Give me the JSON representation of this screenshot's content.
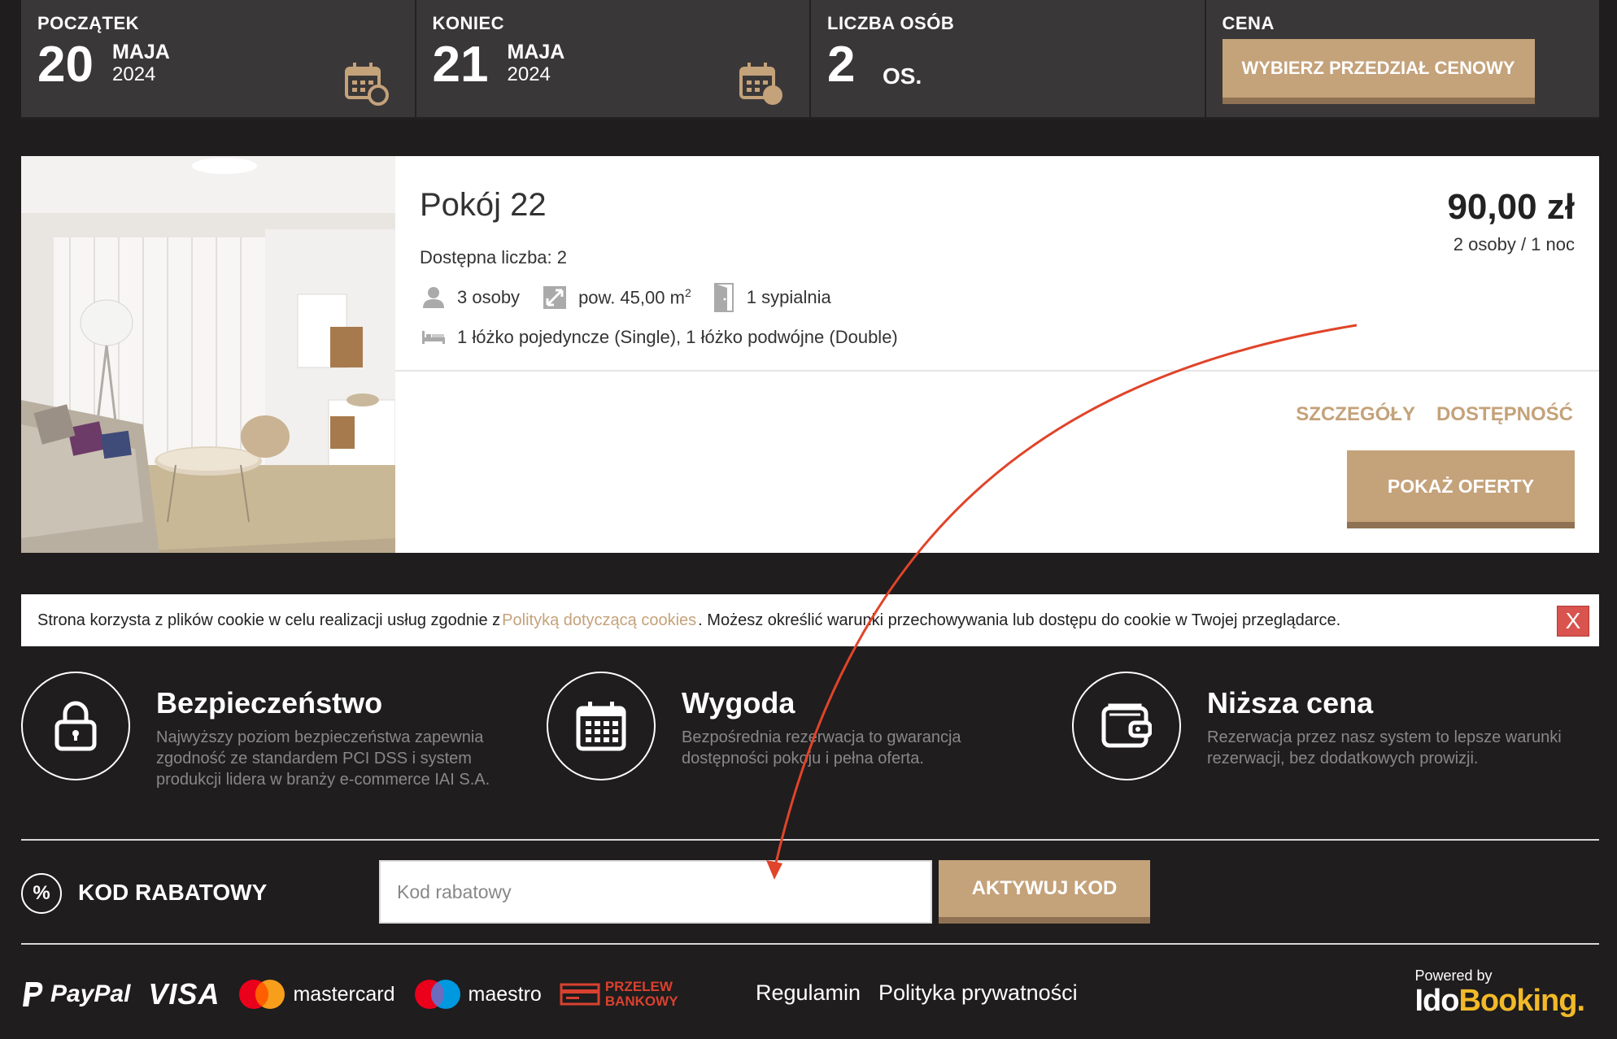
{
  "search": {
    "start": {
      "label": "POCZĄTEK",
      "day": "20",
      "month": "MAJA",
      "year": "2024"
    },
    "end": {
      "label": "KONIEC",
      "day": "21",
      "month": "MAJA",
      "year": "2024"
    },
    "guests": {
      "label": "LICZBA OSÓB",
      "count": "2",
      "unit": "OS."
    },
    "price": {
      "label": "CENA",
      "button": "WYBIERZ PRZEDZIAŁ CENOWY"
    }
  },
  "room": {
    "title": "Pokój 22",
    "availability": "Dostępna liczba: 2",
    "persons": "3 osoby",
    "area": "pow. 45,00 m",
    "area_sup": "2",
    "bedrooms": "1 sypialnia",
    "beds": "1 łóżko pojedyncze (Single), 1 łóżko podwójne (Double)",
    "price": "90,00 zł",
    "price_sub": "2 osoby / 1 noc",
    "details_link": "SZCZEGÓŁY",
    "availability_link": "DOSTĘPNOŚĆ",
    "offers_button": "POKAŻ OFERTY"
  },
  "cookie": {
    "text_before": "Strona korzysta z plików cookie w celu realizacji usług zgodnie z ",
    "link": "Polityką dotyczącą cookies",
    "text_after": ". Możesz określić warunki przechowywania lub dostępu do cookie w Twojej przeglądarce.",
    "close": "X"
  },
  "benefits": [
    {
      "title": "Bezpieczeństwo",
      "desc": "Najwyższy poziom bezpieczeństwa zapewnia zgodność ze standardem PCI DSS i system produkcji lidera w branży e-commerce IAI S.A.",
      "icon": "lock-icon"
    },
    {
      "title": "Wygoda",
      "desc": "Bezpośrednia rezerwacja to gwarancja dostępności pokoju i pełna oferta.",
      "icon": "calendar-grid-icon"
    },
    {
      "title": "Niższa cena",
      "desc": "Rezerwacja przez nasz system to lepsze warunki rezerwacji, bez dodatkowych prowizji.",
      "icon": "wallet-icon"
    }
  ],
  "discount": {
    "icon": "%",
    "label": "KOD RABATOWY",
    "placeholder": "Kod rabatowy",
    "value": "",
    "button": "AKTYWUJ KOD"
  },
  "footer": {
    "payments": {
      "paypal": "PayPal",
      "visa": "VISA",
      "mastercard": "mastercard",
      "maestro": "maestro",
      "przelew_top": "PRZELEW",
      "przelew_bottom": "BANKOWY"
    },
    "terms": "Regulamin",
    "privacy": "Polityka prywatności",
    "powered_by": "Powered by",
    "brand_ido": "Ido",
    "brand_booking": "Booking",
    "brand_dot": "."
  },
  "colors": {
    "accent": "#c4a27a",
    "background": "#1f1d1e",
    "annotation_arrow": "#e0442a"
  }
}
